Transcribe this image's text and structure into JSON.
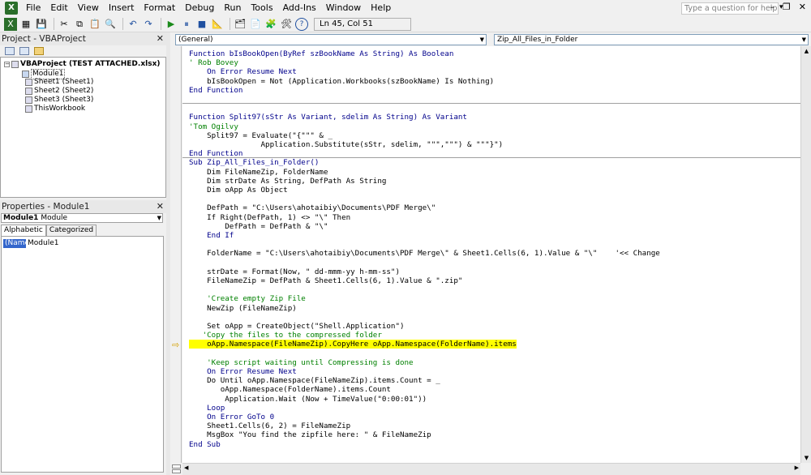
{
  "menu": {
    "items": [
      {
        "label": "File"
      },
      {
        "label": "Edit"
      },
      {
        "label": "View"
      },
      {
        "label": "Insert"
      },
      {
        "label": "Format"
      },
      {
        "label": "Debug"
      },
      {
        "label": "Run"
      },
      {
        "label": "Tools"
      },
      {
        "label": "Add-Ins"
      },
      {
        "label": "Window"
      },
      {
        "label": "Help"
      }
    ],
    "help_placeholder": "Type a question for help"
  },
  "toolbar": {
    "position": "Ln 45, Col 51"
  },
  "project": {
    "title": "Project - VBAProject",
    "root": "VBAProject (TEST ATTACHED.xlsx)",
    "modules": [
      "Module1"
    ],
    "sheets": [
      "Sheet1 (Sheet1)",
      "Sheet2 (Sheet2)",
      "Sheet3 (Sheet3)",
      "ThisWorkbook"
    ]
  },
  "properties": {
    "title": "Properties - Module1",
    "selected_bold": "Module1",
    "selected_rest": "Module",
    "tabs": [
      "Alphabetic",
      "Categorized"
    ],
    "key": "(Name)",
    "value": "Module1"
  },
  "editor": {
    "object_combo": "(General)",
    "proc_combo": "Zip_All_Files_in_Folder",
    "lines": [
      {
        "text": "Function bIsBookOpen(ByRef szBookName As String) As Boolean",
        "cls": "k"
      },
      {
        "text": "' Rob Bovey",
        "cls": "c"
      },
      {
        "text": "    On Error Resume Next",
        "cls": "k"
      },
      {
        "text": "    bIsBookOpen = Not (Application.Workbooks(szBookName) Is Nothing)",
        "cls": ""
      },
      {
        "text": "End Function",
        "cls": "k"
      },
      {
        "text": "",
        "cls": ""
      },
      {
        "text": "",
        "cls": "",
        "sep": true
      },
      {
        "text": "Function Split97(sStr As Variant, sdelim As String) As Variant",
        "cls": "k"
      },
      {
        "text": "'Tom Ogilvy",
        "cls": "c"
      },
      {
        "text": "    Split97 = Evaluate(\"{\"\"\" & _",
        "cls": ""
      },
      {
        "text": "                Application.Substitute(sStr, sdelim, \"\"\",\"\"\") & \"\"\"}\")",
        "cls": ""
      },
      {
        "text": "End Function",
        "cls": "k"
      },
      {
        "text": "Sub Zip_All_Files_in_Folder()",
        "cls": "k",
        "sep": true
      },
      {
        "text": "    Dim FileNameZip, FolderName",
        "cls": ""
      },
      {
        "text": "    Dim strDate As String, DefPath As String",
        "cls": ""
      },
      {
        "text": "    Dim oApp As Object",
        "cls": ""
      },
      {
        "text": "",
        "cls": ""
      },
      {
        "text": "    DefPath = \"C:\\Users\\ahotaibiy\\Documents\\PDF Merge\\\"",
        "cls": ""
      },
      {
        "text": "    If Right(DefPath, 1) <> \"\\\" Then",
        "cls": ""
      },
      {
        "text": "        DefPath = DefPath & \"\\\"",
        "cls": ""
      },
      {
        "text": "    End If",
        "cls": "k"
      },
      {
        "text": "",
        "cls": ""
      },
      {
        "text": "    FolderName = \"C:\\Users\\ahotaibiy\\Documents\\PDF Merge\\\" & Sheet1.Cells(6, 1).Value & \"\\\"    '<< Change",
        "cls": ""
      },
      {
        "text": "",
        "cls": ""
      },
      {
        "text": "    strDate = Format(Now, \" dd-mmm-yy h-mm-ss\")",
        "cls": ""
      },
      {
        "text": "    FileNameZip = DefPath & Sheet1.Cells(6, 1).Value & \".zip\"",
        "cls": ""
      },
      {
        "text": "",
        "cls": ""
      },
      {
        "text": "    'Create empty Zip File",
        "cls": "c"
      },
      {
        "text": "    NewZip (FileNameZip)",
        "cls": ""
      },
      {
        "text": "",
        "cls": ""
      },
      {
        "text": "    Set oApp = CreateObject(\"Shell.Application\")",
        "cls": ""
      },
      {
        "text": "   'Copy the files to the compressed folder",
        "cls": "c"
      },
      {
        "text": "    oApp.Namespace(FileNameZip).CopyHere oApp.Namespace(FolderName).items",
        "cls": "hl"
      },
      {
        "text": "",
        "cls": ""
      },
      {
        "text": "    'Keep script waiting until Compressing is done",
        "cls": "c"
      },
      {
        "text": "    On Error Resume Next",
        "cls": "k"
      },
      {
        "text": "    Do Until oApp.Namespace(FileNameZip).items.Count = _",
        "cls": ""
      },
      {
        "text": "       oApp.Namespace(FolderName).items.Count",
        "cls": ""
      },
      {
        "text": "        Application.Wait (Now + TimeValue(\"0:00:01\"))",
        "cls": ""
      },
      {
        "text": "    Loop",
        "cls": "k"
      },
      {
        "text": "    On Error GoTo 0",
        "cls": "k"
      },
      {
        "text": "    Sheet1.Cells(6, 2) = FileNameZip",
        "cls": ""
      },
      {
        "text": "    MsgBox \"You find the zipfile here: \" & FileNameZip",
        "cls": ""
      },
      {
        "text": "End Sub",
        "cls": "k"
      }
    ]
  }
}
